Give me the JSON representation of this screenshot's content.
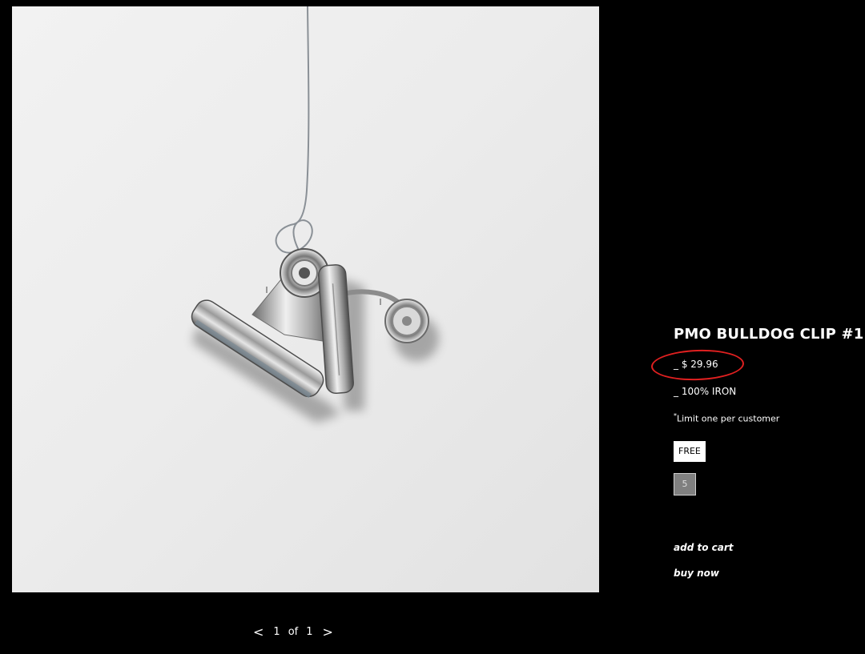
{
  "product": {
    "title": "PMO BULLDOG CLIP #1",
    "price": "_ $ 29.96",
    "material": "_ 100% IRON",
    "limit_marker": "*",
    "limit_text": "Limit one per customer",
    "option_free": "FREE",
    "quantity": "5",
    "add_to_cart": "add to cart",
    "buy_now": "buy now"
  },
  "pager": {
    "prev": "<",
    "current": "1",
    "of": "of",
    "total": "1",
    "next": ">"
  },
  "image": {
    "alt_subject": "silver bulldog clip hanging on wire"
  },
  "colors": {
    "background": "#000000",
    "annotation_circle": "#e02020",
    "quantity_box": "#808080"
  }
}
